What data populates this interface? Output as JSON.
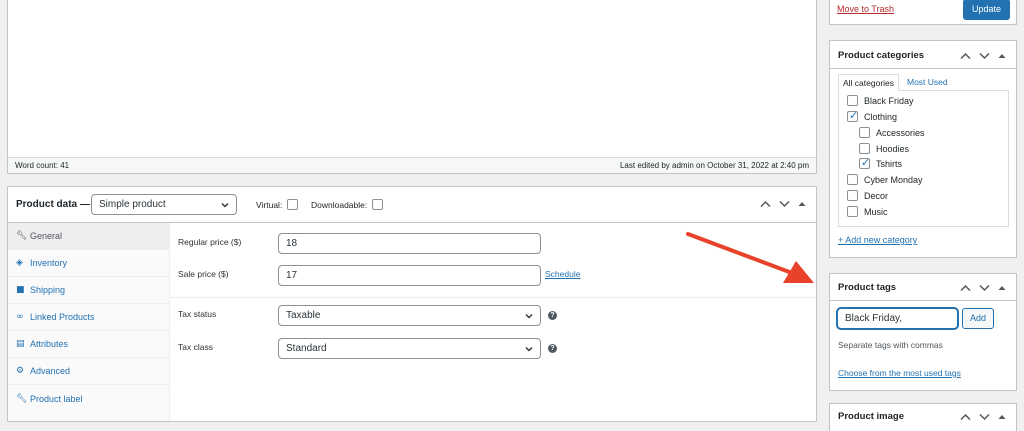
{
  "editor": {
    "word_count": "Word count: 41",
    "last_edited": "Last edited by admin on October 31, 2022 at 2:40 pm"
  },
  "publish": {
    "trash_label": "Move to Trash",
    "update_label": "Update"
  },
  "product_data": {
    "title": "Product data —",
    "type_value": "Simple product",
    "virtual_label": "Virtual:",
    "downloadable_label": "Downloadable:",
    "tabs": [
      {
        "label": "General",
        "icon": "wrench-icon",
        "active": true
      },
      {
        "label": "Inventory",
        "icon": "tag-icon"
      },
      {
        "label": "Shipping",
        "icon": "truck-icon"
      },
      {
        "label": "Linked Products",
        "icon": "link-icon"
      },
      {
        "label": "Attributes",
        "icon": "list-icon"
      },
      {
        "label": "Advanced",
        "icon": "gear-icon"
      },
      {
        "label": "Product label",
        "icon": "wrench-icon"
      }
    ],
    "regular_price_label": "Regular price ($)",
    "regular_price_value": "18",
    "sale_price_label": "Sale price ($)",
    "sale_price_value": "17",
    "schedule_label": "Schedule",
    "tax_status_label": "Tax status",
    "tax_status_value": "Taxable",
    "tax_class_label": "Tax class",
    "tax_class_value": "Standard"
  },
  "categories": {
    "title": "Product categories",
    "tab_all": "All categories",
    "tab_most_used": "Most Used",
    "items": [
      {
        "label": "Black Friday",
        "checked": false,
        "indent": 0
      },
      {
        "label": "Clothing",
        "checked": true,
        "indent": 0
      },
      {
        "label": "Accessories",
        "checked": false,
        "indent": 1
      },
      {
        "label": "Hoodies",
        "checked": false,
        "indent": 1
      },
      {
        "label": "Tshirts",
        "checked": true,
        "indent": 1
      },
      {
        "label": "Cyber Monday",
        "checked": false,
        "indent": 0
      },
      {
        "label": "Decor",
        "checked": false,
        "indent": 0
      },
      {
        "label": "Music",
        "checked": false,
        "indent": 0
      }
    ],
    "add_new": "+ Add new category"
  },
  "tags": {
    "title": "Product tags",
    "input_value": "Black Friday,",
    "add_label": "Add",
    "hint": "Separate tags with commas",
    "most_used_link": "Choose from the most used tags"
  },
  "image": {
    "title": "Product image"
  },
  "colors": {
    "accent": "#2271b1",
    "arrow": "#e8432a",
    "trash": "#b32d2e"
  }
}
